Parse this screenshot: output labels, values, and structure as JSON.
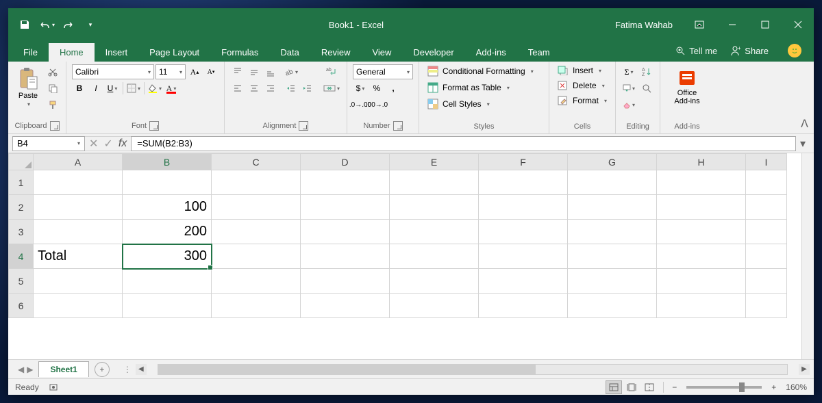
{
  "title": "Book1 - Excel",
  "user": "Fatima Wahab",
  "qat": {
    "save": "save-icon",
    "undo": "undo-icon",
    "redo": "redo-icon"
  },
  "tabs": [
    "File",
    "Home",
    "Insert",
    "Page Layout",
    "Formulas",
    "Data",
    "Review",
    "View",
    "Developer",
    "Add-ins",
    "Team"
  ],
  "active_tab": "Home",
  "tellme": "Tell me",
  "share": "Share",
  "ribbon": {
    "clipboard": {
      "label": "Clipboard",
      "paste": "Paste"
    },
    "font": {
      "label": "Font",
      "name": "Calibri",
      "size": "11"
    },
    "alignment": {
      "label": "Alignment"
    },
    "number": {
      "label": "Number",
      "format": "General"
    },
    "styles": {
      "label": "Styles",
      "conditional": "Conditional Formatting",
      "table": "Format as Table",
      "cellstyles": "Cell Styles"
    },
    "cells": {
      "label": "Cells",
      "insert": "Insert",
      "delete": "Delete",
      "format": "Format"
    },
    "editing": {
      "label": "Editing"
    },
    "addins": {
      "label": "Add-ins",
      "office": "Office Add-ins"
    }
  },
  "formula_bar": {
    "name_box": "B4",
    "formula": "=SUM(B2:B3)"
  },
  "columns": [
    "A",
    "B",
    "C",
    "D",
    "E",
    "F",
    "G",
    "H",
    "I"
  ],
  "rows": [
    "1",
    "2",
    "3",
    "4",
    "5",
    "6"
  ],
  "active_cell": {
    "row": 4,
    "col": "B"
  },
  "cells": {
    "A4": "Total",
    "B2": "100",
    "B3": "200",
    "B4": "300"
  },
  "sheet_tab": "Sheet1",
  "status": "Ready",
  "zoom": "160%"
}
